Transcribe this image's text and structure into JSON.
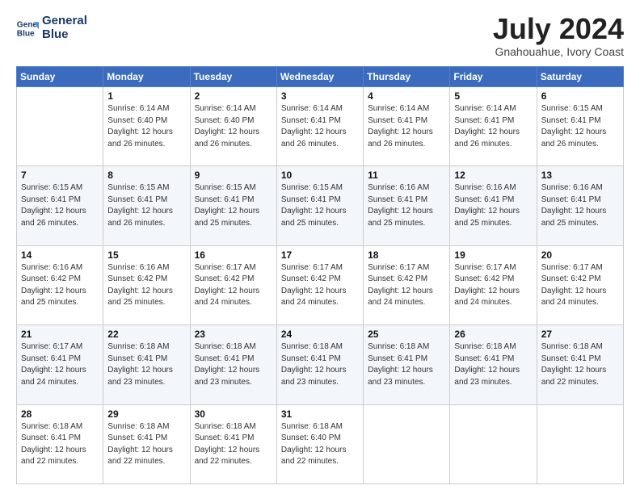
{
  "logo": {
    "line1": "General",
    "line2": "Blue"
  },
  "title": "July 2024",
  "subtitle": "Gnahouahue, Ivory Coast",
  "headers": [
    "Sunday",
    "Monday",
    "Tuesday",
    "Wednesday",
    "Thursday",
    "Friday",
    "Saturday"
  ],
  "weeks": [
    [
      {
        "day": "",
        "info": ""
      },
      {
        "day": "1",
        "info": "Sunrise: 6:14 AM\nSunset: 6:40 PM\nDaylight: 12 hours\nand 26 minutes."
      },
      {
        "day": "2",
        "info": "Sunrise: 6:14 AM\nSunset: 6:40 PM\nDaylight: 12 hours\nand 26 minutes."
      },
      {
        "day": "3",
        "info": "Sunrise: 6:14 AM\nSunset: 6:41 PM\nDaylight: 12 hours\nand 26 minutes."
      },
      {
        "day": "4",
        "info": "Sunrise: 6:14 AM\nSunset: 6:41 PM\nDaylight: 12 hours\nand 26 minutes."
      },
      {
        "day": "5",
        "info": "Sunrise: 6:14 AM\nSunset: 6:41 PM\nDaylight: 12 hours\nand 26 minutes."
      },
      {
        "day": "6",
        "info": "Sunrise: 6:15 AM\nSunset: 6:41 PM\nDaylight: 12 hours\nand 26 minutes."
      }
    ],
    [
      {
        "day": "7",
        "info": ""
      },
      {
        "day": "8",
        "info": "Sunrise: 6:15 AM\nSunset: 6:41 PM\nDaylight: 12 hours\nand 26 minutes."
      },
      {
        "day": "9",
        "info": "Sunrise: 6:15 AM\nSunset: 6:41 PM\nDaylight: 12 hours\nand 25 minutes."
      },
      {
        "day": "10",
        "info": "Sunrise: 6:15 AM\nSunset: 6:41 PM\nDaylight: 12 hours\nand 25 minutes."
      },
      {
        "day": "11",
        "info": "Sunrise: 6:16 AM\nSunset: 6:41 PM\nDaylight: 12 hours\nand 25 minutes."
      },
      {
        "day": "12",
        "info": "Sunrise: 6:16 AM\nSunset: 6:41 PM\nDaylight: 12 hours\nand 25 minutes."
      },
      {
        "day": "13",
        "info": "Sunrise: 6:16 AM\nSunset: 6:41 PM\nDaylight: 12 hours\nand 25 minutes."
      }
    ],
    [
      {
        "day": "14",
        "info": ""
      },
      {
        "day": "15",
        "info": "Sunrise: 6:16 AM\nSunset: 6:42 PM\nDaylight: 12 hours\nand 25 minutes."
      },
      {
        "day": "16",
        "info": "Sunrise: 6:17 AM\nSunset: 6:42 PM\nDaylight: 12 hours\nand 24 minutes."
      },
      {
        "day": "17",
        "info": "Sunrise: 6:17 AM\nSunset: 6:42 PM\nDaylight: 12 hours\nand 24 minutes."
      },
      {
        "day": "18",
        "info": "Sunrise: 6:17 AM\nSunset: 6:42 PM\nDaylight: 12 hours\nand 24 minutes."
      },
      {
        "day": "19",
        "info": "Sunrise: 6:17 AM\nSunset: 6:42 PM\nDaylight: 12 hours\nand 24 minutes."
      },
      {
        "day": "20",
        "info": "Sunrise: 6:17 AM\nSunset: 6:42 PM\nDaylight: 12 hours\nand 24 minutes."
      }
    ],
    [
      {
        "day": "21",
        "info": ""
      },
      {
        "day": "22",
        "info": "Sunrise: 6:18 AM\nSunset: 6:41 PM\nDaylight: 12 hours\nand 23 minutes."
      },
      {
        "day": "23",
        "info": "Sunrise: 6:18 AM\nSunset: 6:41 PM\nDaylight: 12 hours\nand 23 minutes."
      },
      {
        "day": "24",
        "info": "Sunrise: 6:18 AM\nSunset: 6:41 PM\nDaylight: 12 hours\nand 23 minutes."
      },
      {
        "day": "25",
        "info": "Sunrise: 6:18 AM\nSunset: 6:41 PM\nDaylight: 12 hours\nand 23 minutes."
      },
      {
        "day": "26",
        "info": "Sunrise: 6:18 AM\nSunset: 6:41 PM\nDaylight: 12 hours\nand 23 minutes."
      },
      {
        "day": "27",
        "info": "Sunrise: 6:18 AM\nSunset: 6:41 PM\nDaylight: 12 hours\nand 22 minutes."
      }
    ],
    [
      {
        "day": "28",
        "info": "Sunrise: 6:18 AM\nSunset: 6:41 PM\nDaylight: 12 hours\nand 22 minutes."
      },
      {
        "day": "29",
        "info": "Sunrise: 6:18 AM\nSunset: 6:41 PM\nDaylight: 12 hours\nand 22 minutes."
      },
      {
        "day": "30",
        "info": "Sunrise: 6:18 AM\nSunset: 6:41 PM\nDaylight: 12 hours\nand 22 minutes."
      },
      {
        "day": "31",
        "info": "Sunrise: 6:18 AM\nSunset: 6:40 PM\nDaylight: 12 hours\nand 22 minutes."
      },
      {
        "day": "",
        "info": ""
      },
      {
        "day": "",
        "info": ""
      },
      {
        "day": "",
        "info": ""
      }
    ]
  ],
  "week7_sunday_info": "Sunrise: 6:15 AM\nSunset: 6:41 PM\nDaylight: 12 hours\nand 26 minutes.",
  "week14_sunday_info": "Sunrise: 6:16 AM\nSunset: 6:42 PM\nDaylight: 12 hours\nand 25 minutes.",
  "week21_sunday_info": "Sunrise: 6:17 AM\nSunset: 6:41 PM\nDaylight: 12 hours\nand 24 minutes."
}
